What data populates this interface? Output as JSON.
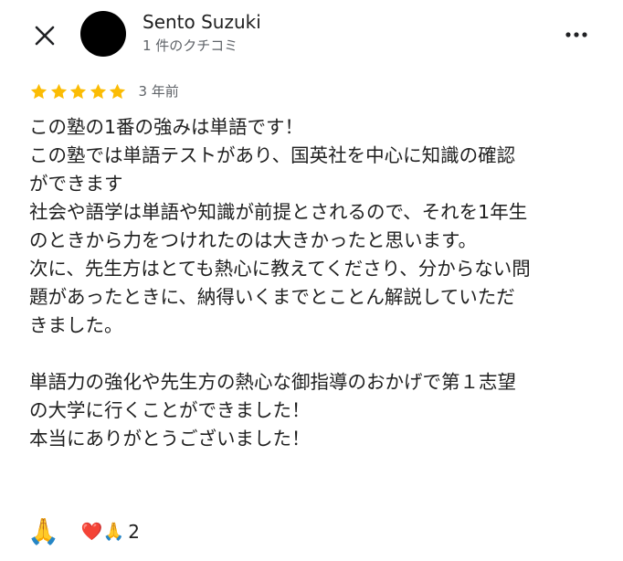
{
  "reviewer": {
    "name": "Sento Suzuki",
    "meta": "1 件のクチコミ"
  },
  "review": {
    "rating": 5,
    "max_rating": 5,
    "age": "3 年前",
    "lines": [
      "この塾の1番の強みは単語です！",
      "この塾では単語テストがあり、国英社を中心に知識の確認",
      "ができます",
      "社会や語学は単語や知識が前提とされるので、それを1年生",
      "のときから力をつけれたのは大きかったと思います。",
      "次に、先生方はとても熱心に教えてくださり、分からない問",
      "題があったときに、納得いくまでとことん解説していただ",
      "きました。",
      "",
      "単語力の強化や先生方の熱心な御指導のおかげで第１志望",
      "の大学に行くことができました！",
      "本当にありがとうございました！"
    ]
  },
  "reactions": {
    "add_emoji": "🙏",
    "summary_icons": "❤️🙏",
    "count": "2"
  },
  "colors": {
    "star": "#fbbc04",
    "text_primary": "#1f1f1f",
    "text_secondary": "#5f6368"
  },
  "icons": {
    "close": "close-icon",
    "more": "more-vert-icon",
    "star": "star-icon"
  }
}
